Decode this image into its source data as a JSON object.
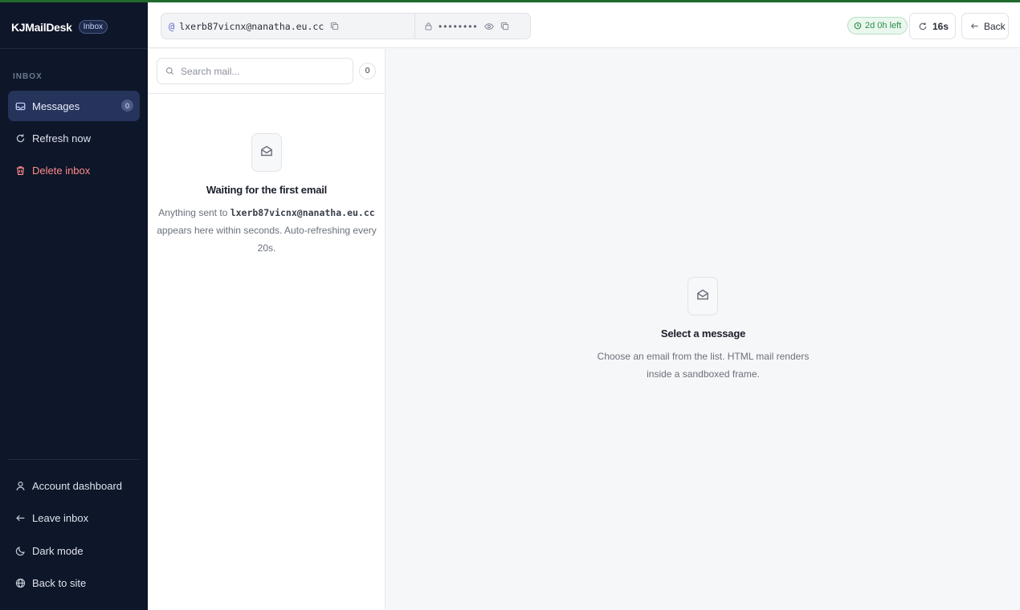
{
  "app": {
    "brand": "KJMailDesk",
    "badge": "Inbox"
  },
  "sidebar": {
    "section_label": "INBOX",
    "items": [
      {
        "label": "Messages",
        "icon": "inbox-icon",
        "count": "0",
        "active": true
      },
      {
        "label": "Refresh now",
        "icon": "refresh-icon"
      },
      {
        "label": "Delete inbox",
        "icon": "trash-icon"
      }
    ],
    "footer_items": [
      {
        "label": "Account dashboard",
        "icon": "user-icon"
      },
      {
        "label": "Leave inbox",
        "icon": "arrow-left-icon"
      },
      {
        "label": "Dark mode",
        "icon": "moon-icon"
      },
      {
        "label": "Back to site",
        "icon": "globe-icon"
      }
    ]
  },
  "topbar": {
    "email": "lxerb87vicnx@nanatha.eu.cc",
    "password_mask": "••••••••",
    "expires": "2d 0h left",
    "refresh_timer": "16s",
    "back_label": "Back"
  },
  "list": {
    "search_placeholder": "Search mail...",
    "count": "0",
    "empty_title": "Waiting for the first email",
    "empty_text_prefix": "Anything sent to",
    "empty_email": "lxerb87vicnx@nanatha.eu.cc",
    "empty_text_line2": "appears here within seconds. Auto-refreshing every",
    "empty_text_line3": "20s."
  },
  "viewer": {
    "title": "Select a message",
    "line1": "Choose an email from the list. HTML mail renders",
    "line2": "inside a sandboxed frame."
  },
  "colors": {
    "sidebar_bg": "#0e1629",
    "active_item": "#26335a",
    "danger": "#ff8a8a",
    "accent_green": "#2c8c49",
    "top_line": "#1f6a2c"
  }
}
